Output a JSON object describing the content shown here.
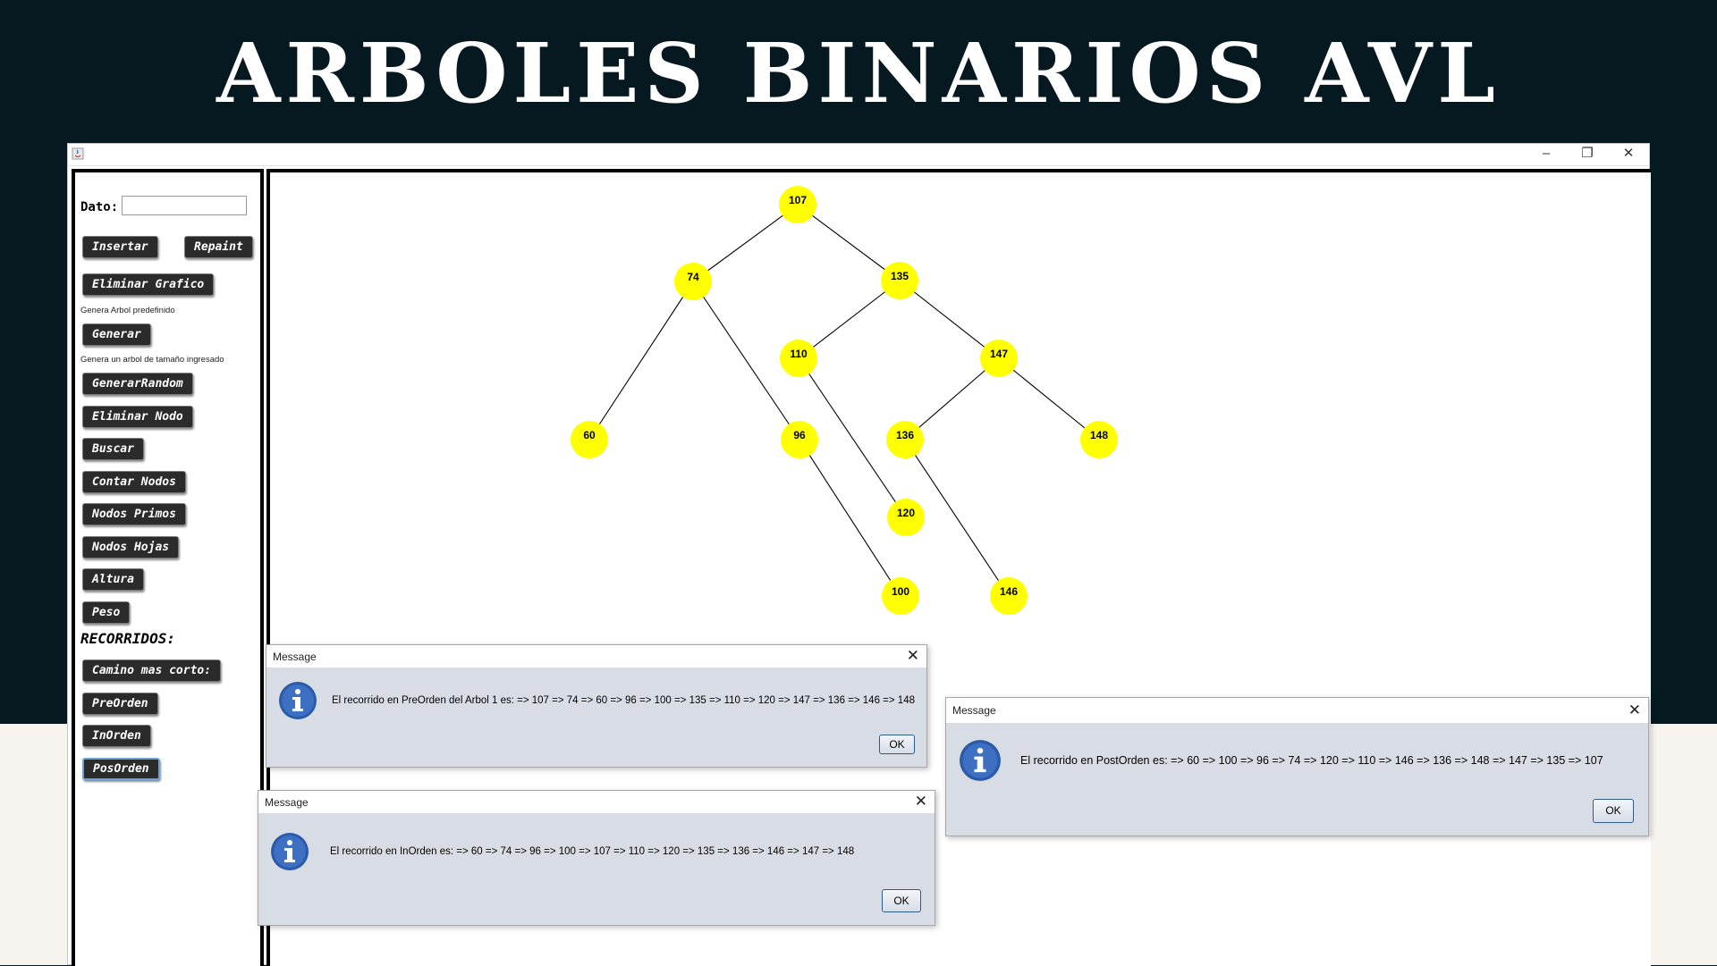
{
  "banner": {
    "title": "ARBOLES BINARIOS AVL"
  },
  "window": {
    "controls": {
      "minimize": "–",
      "maximize": "❐",
      "close": "✕"
    }
  },
  "left_panel": {
    "dato_label": "Dato:",
    "dato_value": "",
    "buttons": {
      "insertar": "Insertar",
      "repaint": "Repaint",
      "eliminar_grafico": "Eliminar Grafico",
      "generar": "Generar",
      "generar_random": "GenerarRandom",
      "eliminar_nodo": "Eliminar Nodo",
      "buscar": "Buscar",
      "contar_nodos": "Contar Nodos",
      "nodos_primos": "Nodos Primos",
      "nodos_hojas": "Nodos Hojas",
      "altura": "Altura",
      "peso": "Peso",
      "camino_mas_corto": "Camino mas corto:",
      "preorden": "PreOrden",
      "inorden": "InOrden",
      "posorden": "PosOrden"
    },
    "hint_generar": "Genera Arbol predefinido",
    "hint_random": "Genera un arbol de tamaño ingresado",
    "recorridos_label": "RECORRIDOS:"
  },
  "tree": {
    "node_color": "#ffff00",
    "nodes": [
      {
        "value": "107"
      },
      {
        "value": "74"
      },
      {
        "value": "135"
      },
      {
        "value": "110"
      },
      {
        "value": "147"
      },
      {
        "value": "60"
      },
      {
        "value": "96"
      },
      {
        "value": "136"
      },
      {
        "value": "148"
      },
      {
        "value": "120"
      },
      {
        "value": "100"
      },
      {
        "value": "146"
      }
    ],
    "edges": [
      [
        "107",
        "74"
      ],
      [
        "107",
        "135"
      ],
      [
        "74",
        "60"
      ],
      [
        "74",
        "96"
      ],
      [
        "96",
        "100"
      ],
      [
        "135",
        "110"
      ],
      [
        "135",
        "147"
      ],
      [
        "110",
        "120"
      ],
      [
        "147",
        "136"
      ],
      [
        "147",
        "148"
      ],
      [
        "136",
        "146"
      ]
    ]
  },
  "dialogs": {
    "preorden": {
      "title": "Message",
      "message": "El recorrido en PreOrden del Arbol 1 es:  => 107 => 74 => 60 => 96 => 100 => 135 => 110 => 120 => 147 => 136 => 146 => 148",
      "ok": "OK"
    },
    "inorden": {
      "title": "Message",
      "message": "El recorrido en InOrden es:  => 60 => 74 => 96 => 100 => 107 => 110 => 120 => 135 => 136 => 146 => 147 => 148",
      "ok": "OK"
    },
    "postorden": {
      "title": "Message",
      "message": "El recorrido en PostOrden es:  => 60 => 100 => 96 => 74 => 120 => 110 => 146 => 136 => 148 => 147 => 135 => 107",
      "ok": "OK"
    }
  },
  "icons": {
    "info": "info-icon",
    "java": "java-app-icon"
  }
}
